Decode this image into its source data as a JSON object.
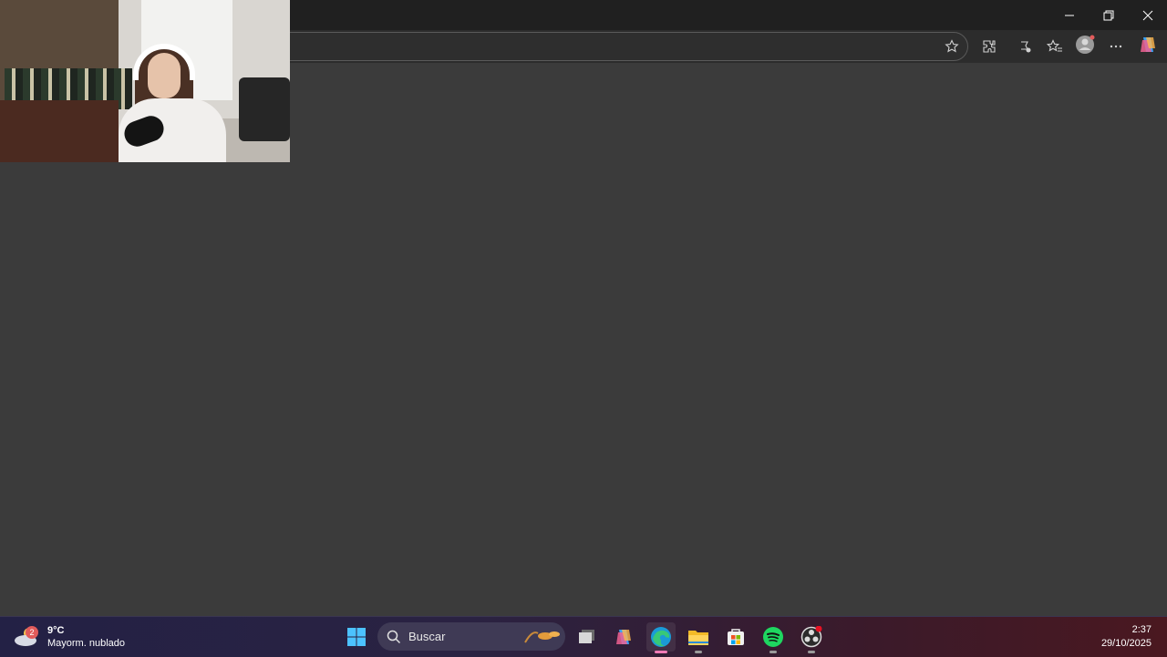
{
  "browser": {
    "window_controls": {
      "minimize": "minimize",
      "restore": "restore",
      "close": "close"
    },
    "toolbar_icons": [
      "star-icon",
      "extensions-icon",
      "read-aloud-icon",
      "favorites-icon",
      "profile-icon",
      "more-icon",
      "copilot-icon"
    ]
  },
  "taskbar": {
    "weather": {
      "badge": "2",
      "temp": "9°C",
      "condition": "Mayorm. nublado"
    },
    "search": {
      "label": "Buscar"
    },
    "apps": [
      "start-icon",
      "task-view-icon",
      "copilot-icon",
      "edge-icon",
      "file-explorer-icon",
      "store-icon",
      "spotify-icon",
      "obs-icon"
    ],
    "clock": {
      "time": "2:37",
      "date": "29/10/2025"
    }
  },
  "colors": {
    "accent": "#f07ab6",
    "spotify": "#1ed760",
    "edge": "#1a9bd7"
  }
}
